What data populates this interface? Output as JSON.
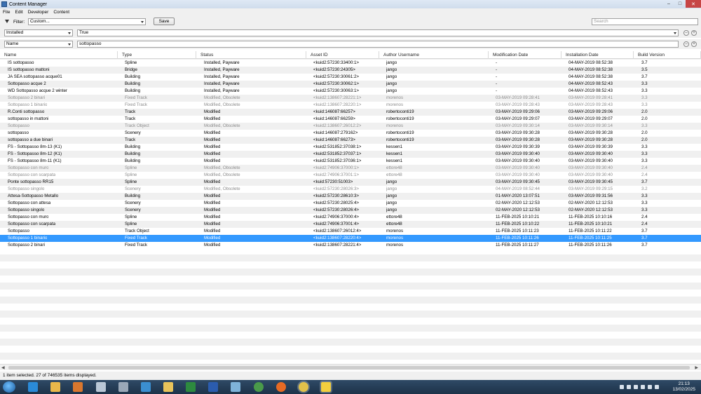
{
  "window": {
    "title": "Content Manager",
    "minimize": "–",
    "maximize": "□",
    "close": "✕"
  },
  "menu": [
    "File",
    "Edit",
    "Developer",
    "Content"
  ],
  "toolbar": {
    "filter_label": "Filter:",
    "filter_value": "Custom...",
    "save_label": "Save",
    "search_placeholder": "Search"
  },
  "filters": [
    {
      "field": "Installed",
      "value": "True"
    },
    {
      "field": "Name",
      "value": "sottopasso"
    }
  ],
  "columns": [
    "Name",
    "Type",
    "Status",
    "Asset ID",
    "Author Username",
    "Modification Date",
    "Installation Date",
    "Build Version"
  ],
  "rows": [
    [
      "IS sottopasso",
      "Spline",
      "Installed, Payware",
      "<kuid2:57230:33400:1>",
      "jango",
      "-",
      "04-MAY-2019 08:52:38",
      "3.7"
    ],
    [
      "IS sottopasso mattoni",
      "Bridge",
      "Installed, Payware",
      "<kuid2:57230:24305>",
      "jango",
      "-",
      "04-MAY-2019 08:52:38",
      "3.5"
    ],
    [
      "JA SEA sottopasso acque01",
      "Building",
      "Installed, Payware",
      "<kuid2:57230:30061:2>",
      "jango",
      "-",
      "04-MAY-2019 08:52:38",
      "3.7"
    ],
    [
      "Sottopasso acque 2",
      "Building",
      "Installed, Payware",
      "<kuid2:57230:30062:1>",
      "jango",
      "-",
      "04-MAY-2019 08:52:43",
      "3.3"
    ],
    [
      "WD Sottopasso acque 2 winter",
      "Building",
      "Installed, Payware",
      "<kuid2:57230:30063:1>",
      "jango",
      "-",
      "04-MAY-2019 08:52:43",
      "3.3"
    ],
    [
      "Sottopasso 2 binari",
      "Fixed Track",
      "Modified, Obsolete",
      "<kuid2:138607:28221:1>",
      "morenos",
      "03-MAY-2019 09:28:41",
      "03-MAY-2019 09:28:41",
      "3.3"
    ],
    [
      "Sottopasso 1 binario",
      "Fixed Track",
      "Modified, Obsolete",
      "<kuid2:138607:28220:1>",
      "morenos",
      "03-MAY-2019 09:28:43",
      "03-MAY-2019 09:28:43",
      "3.3"
    ],
    [
      "R.Conti sottopasso",
      "Track",
      "Modified",
      "<kuid:146087:66257>",
      "robertoconti19",
      "03-MAY-2019 09:29:06",
      "03-MAY-2019 09:29:06",
      "2.0"
    ],
    [
      "sottopasso in mattoni",
      "Track",
      "Modified",
      "<kuid:146087:66259>",
      "robertoconti19",
      "03-MAY-2019 09:29:07",
      "03-MAY-2019 09:29:07",
      "2.0"
    ],
    [
      "Sottopasso",
      "Track Object",
      "Modified, Obsolete",
      "<kuid2:138607:26012:2>",
      "morenos",
      "03-MAY-2019 09:30:14",
      "03-MAY-2019 09:30:14",
      "3.3"
    ],
    [
      "sottopasso",
      "Scenery",
      "Modified",
      "<kuid:146087:279162>",
      "robertoconti19",
      "03-MAY-2019 09:30:28",
      "03-MAY-2019 09:30:28",
      "2.0"
    ],
    [
      "sottopasso a due binari",
      "Track",
      "Modified",
      "<kuid:146087:66273>",
      "robertoconti19",
      "03-MAY-2019 09:30:28",
      "03-MAY-2019 09:30:28",
      "2.0"
    ],
    [
      "FS - Sottopasso 8m-13 (K1)",
      "Building",
      "Modified",
      "<kuid2:531852:37038:1>",
      "kessen1",
      "03-MAY-2019 09:30:39",
      "03-MAY-2019 09:30:39",
      "3.3"
    ],
    [
      "FS - Sottopasso 8m-12 (K1)",
      "Building",
      "Modified",
      "<kuid2:531852:37037:1>",
      "kessen1",
      "03-MAY-2019 09:30:40",
      "03-MAY-2019 09:30:40",
      "3.3"
    ],
    [
      "FS - Sottopasso 8m-11 (K1)",
      "Building",
      "Modified",
      "<kuid2:531852:37036:1>",
      "kessen1",
      "03-MAY-2019 09:30:40",
      "03-MAY-2019 09:30:40",
      "3.3"
    ],
    [
      "Sottopasso con muro",
      "Spline",
      "Modified, Obsolete",
      "<kuid2:74906:37000:1>",
      "ettore48",
      "03-MAY-2019 09:30:40",
      "03-MAY-2019 09:30:40",
      "2.4"
    ],
    [
      "Sottopasso con scarpata",
      "Spline",
      "Modified, Obsolete",
      "<kuid2:74906:37001:1>",
      "ettore48",
      "03-MAY-2019 09:30:40",
      "03-MAY-2019 09:30:40",
      "2.4"
    ],
    [
      "Ponte sottopasso RR15",
      "Spline",
      "Modified",
      "<kuid:57230:51003>",
      "jango",
      "03-MAY-2019 09:30:45",
      "03-MAY-2019 09:30:45",
      "3.7"
    ],
    [
      "Sottopasso singolo",
      "Scenery",
      "Modified, Obsolete",
      "<kuid2:57230:28026:3>",
      "jango",
      "04-MAY-2019 08:52:44",
      "03-MAY-2019 09:29:15",
      "3.2"
    ],
    [
      "Attesa-Sottopasso Metallo",
      "Building",
      "Modified",
      "<kuid2:57230:28610:3>",
      "jango",
      "01-MAY-2020 13:07:51",
      "03-MAY-2019 09:31:56",
      "3.3"
    ],
    [
      "Sottopasso con attesa",
      "Scenery",
      "Modified",
      "<kuid2:57230:28025:4>",
      "jango",
      "02-MAY-2020 12:12:53",
      "02-MAY-2020 12:12:53",
      "3.3"
    ],
    [
      "Sottopasso singolo",
      "Scenery",
      "Modified",
      "<kuid2:57230:28026:4>",
      "jango",
      "02-MAY-2020 12:12:53",
      "02-MAY-2020 12:12:53",
      "3.3"
    ],
    [
      "Sottopasso con muro",
      "Spline",
      "Modified",
      "<kuid2:74906:37000:4>",
      "ettore48",
      "11-FEB-2025 10:10:21",
      "11-FEB-2025 10:10:16",
      "2.4"
    ],
    [
      "Sottopasso con scarpata",
      "Spline",
      "Modified",
      "<kuid2:74906:37001:4>",
      "ettore48",
      "11-FEB-2025 10:10:22",
      "11-FEB-2025 10:10:21",
      "2.4"
    ],
    [
      "Sottopasso",
      "Track Object",
      "Modified",
      "<kuid2:138607:26012:4>",
      "morenos",
      "11-FEB-2025 10:11:23",
      "11-FEB-2025 10:11:22",
      "3.7"
    ],
    [
      "Sottopasso 1 binario",
      "Fixed Track",
      "Modified",
      "<kuid2:138607:28220:4>",
      "morenos",
      "11-FEB-2025 10:11:26",
      "11-FEB-2025 10:11:25",
      "3.7"
    ],
    [
      "Sottopasso 2 binari",
      "Fixed Track",
      "Modified",
      "<kuid2:138607:28221:4>",
      "morenos",
      "11-FEB-2025 10:11:27",
      "11-FEB-2025 10:11:26",
      "3.7"
    ]
  ],
  "status_bar": "1 item selected. 27 of 746535 items displayed.",
  "taskbar": {
    "icons": [
      "windows-start-icon",
      "internet-explorer-icon",
      "file-explorer-icon",
      "media-player-icon",
      "documents-icon",
      "app-icon",
      "trainz-icon",
      "folder-icon",
      "excel-icon",
      "word-icon",
      "notes-icon",
      "ubuntu-app-icon",
      "firefox-icon",
      "chrome-icon",
      "content-manager-icon"
    ],
    "clock_time": "21:13",
    "clock_date": "13/02/2025"
  }
}
